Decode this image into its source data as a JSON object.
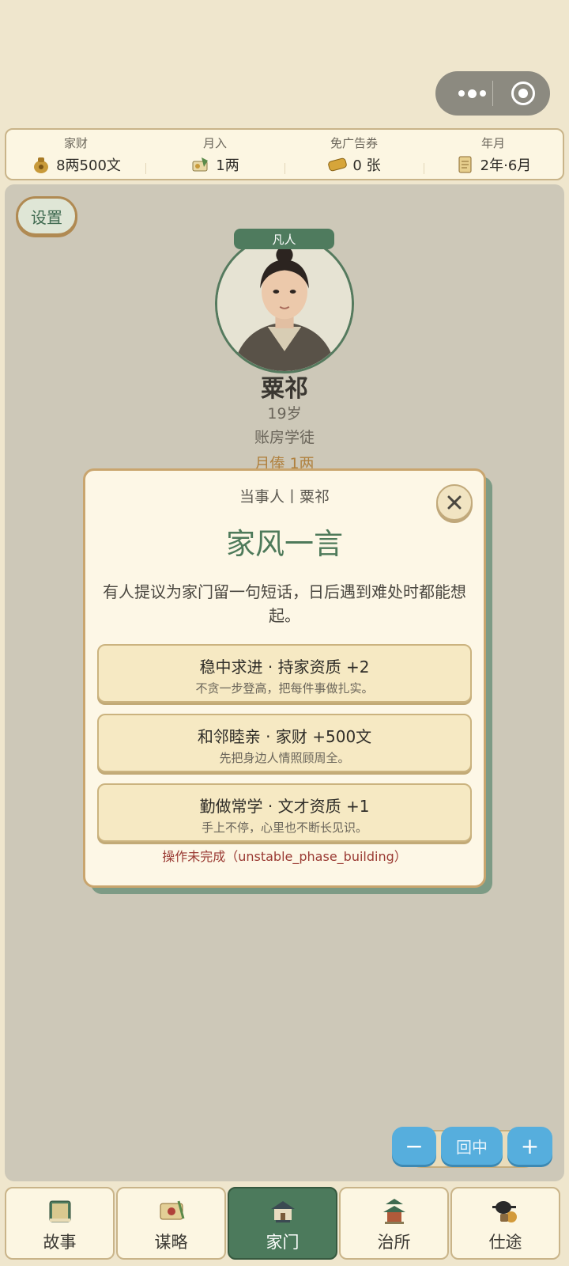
{
  "stats": [
    {
      "label": "家财",
      "value": "8两500文",
      "icon": "money-pouch-icon"
    },
    {
      "label": "月入",
      "value": "1两",
      "icon": "income-scroll-icon"
    },
    {
      "label": "免广告券",
      "value": "0 张",
      "icon": "ticket-icon"
    },
    {
      "label": "年月",
      "value": "2年·6月",
      "icon": "calendar-scroll-icon"
    }
  ],
  "settings_label": "设置",
  "character": {
    "rank": "凡人",
    "name": "粟祁",
    "age": "19岁",
    "job": "账房学徒",
    "salary": "月俸 1两"
  },
  "modal": {
    "subtitle": "当事人丨粟祁",
    "title": "家风一言",
    "description": "有人提议为家门留一句短话，日后遇到难处时都能想起。",
    "options": [
      {
        "title": "稳中求进 · 持家资质 +2",
        "desc": "不贪一步登高，把每件事做扎实。"
      },
      {
        "title": "和邻睦亲 · 家财 +500文",
        "desc": "先把身边人情照顾周全。"
      },
      {
        "title": "勤做常学 · 文才资质 +1",
        "desc": "手上不停，心里也不断长见识。"
      }
    ],
    "error": "操作未完成（unstable_phase_building）"
  },
  "zoom": {
    "minus": "−",
    "center": "回中",
    "plus": "+"
  },
  "tabs": [
    {
      "label": "故事",
      "icon": "story-book-icon",
      "active": false
    },
    {
      "label": "谋略",
      "icon": "strategy-scroll-icon",
      "active": false
    },
    {
      "label": "家门",
      "icon": "family-house-icon",
      "active": true
    },
    {
      "label": "治所",
      "icon": "office-pavilion-icon",
      "active": false
    },
    {
      "label": "仕途",
      "icon": "official-hat-icon",
      "active": false
    }
  ],
  "colors": {
    "accent": "#4c7a5c",
    "gold": "#b0813e",
    "zoom": "#56aedd",
    "background": "#efe6cd",
    "error": "#9a3a33"
  }
}
